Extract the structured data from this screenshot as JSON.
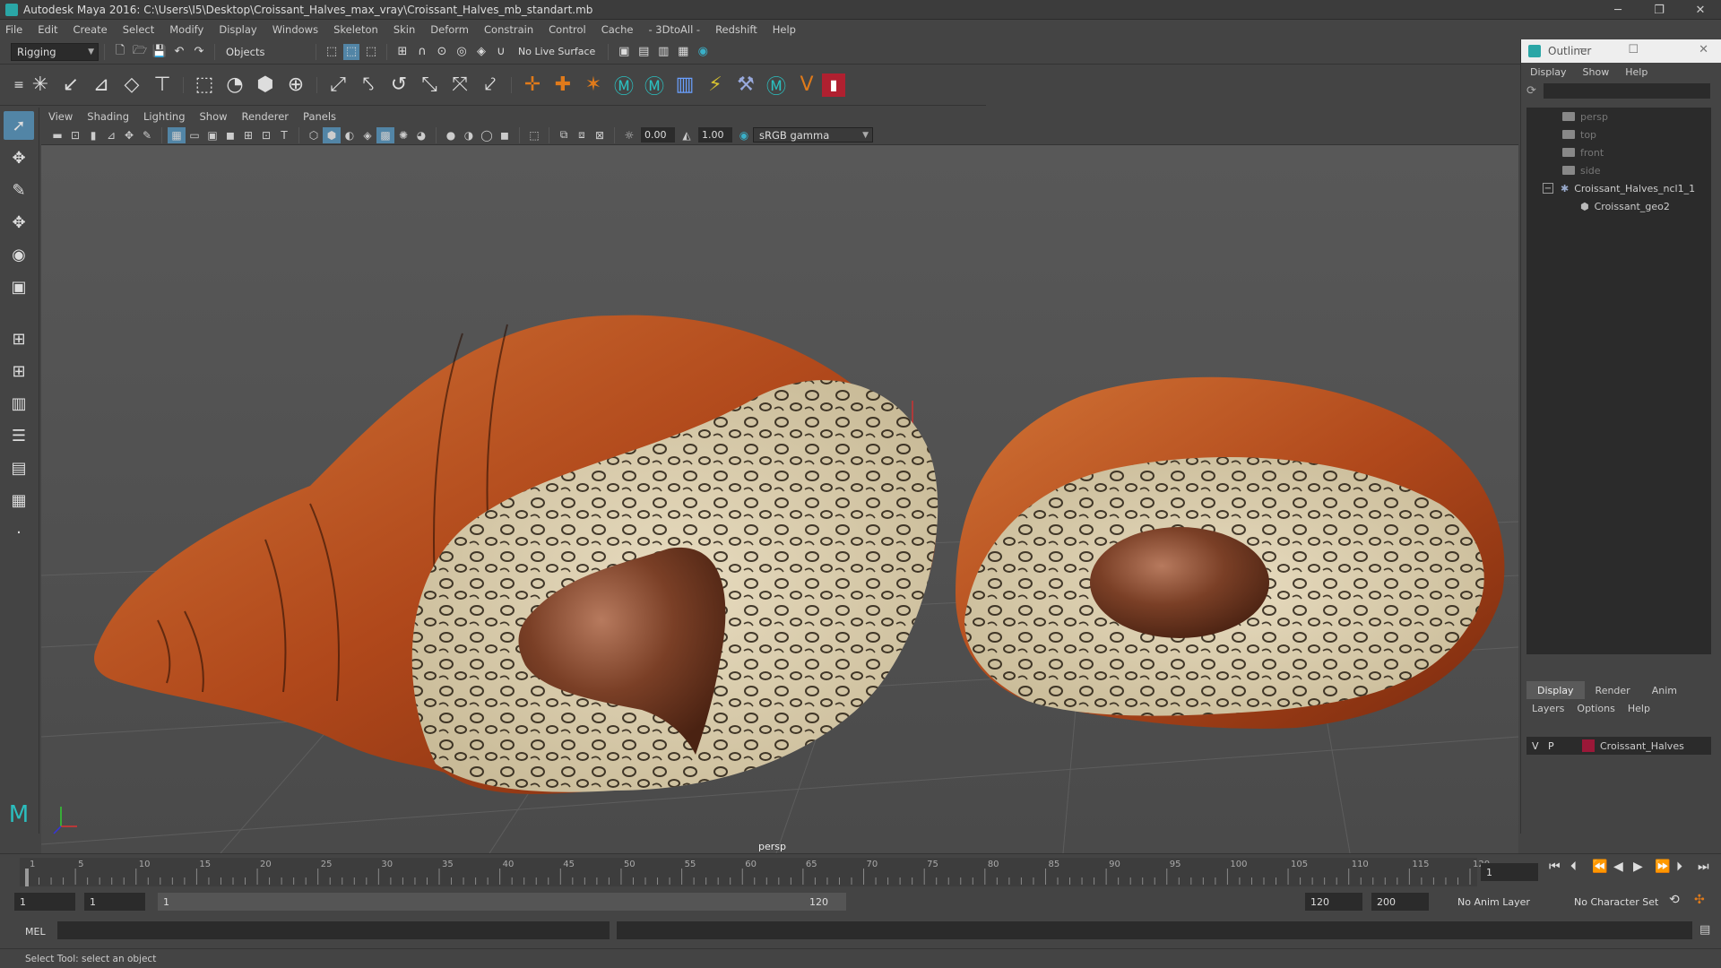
{
  "title_bar": {
    "title": "Autodesk Maya 2016: C:\\Users\\I5\\Desktop\\Croissant_Halves_max_vray\\Croissant_Halves_mb_standart.mb",
    "minimize": "─",
    "maximize": "❐",
    "close": "✕"
  },
  "menu": [
    "File",
    "Edit",
    "Create",
    "Select",
    "Modify",
    "Display",
    "Windows",
    "Skeleton",
    "Skin",
    "Deform",
    "Constrain",
    "Control",
    "Cache",
    "- 3DtoAll -",
    "Redshift",
    "Help"
  ],
  "status_line": {
    "mode": "Rigging",
    "select_mode": "Objects",
    "live_surface": "No Live Surface"
  },
  "panel_menu": [
    "View",
    "Shading",
    "Lighting",
    "Show",
    "Renderer",
    "Panels"
  ],
  "panel_toolbar": {
    "exposure": "0.00",
    "gamma": "1.00",
    "color_space": "sRGB gamma"
  },
  "viewport": {
    "camera": "persp"
  },
  "outliner": {
    "title": "Outliner",
    "menu": [
      "Display",
      "Show",
      "Help"
    ],
    "items": [
      {
        "label": "persp",
        "dim": true
      },
      {
        "label": "top",
        "dim": true
      },
      {
        "label": "front",
        "dim": true
      },
      {
        "label": "side",
        "dim": true
      },
      {
        "label": "Croissant_Halves_ncl1_1",
        "dim": false
      },
      {
        "label": "Croissant_geo2",
        "dim": false
      }
    ]
  },
  "layers": {
    "tabs": [
      "Display",
      "Render",
      "Anim"
    ],
    "menu": [
      "Layers",
      "Options",
      "Help"
    ],
    "layer": {
      "v": "V",
      "p": "P",
      "name": "Croissant_Halves",
      "color": "#9b1838"
    }
  },
  "time_slider": {
    "ticks": [
      "1",
      "5",
      "10",
      "15",
      "20",
      "25",
      "30",
      "35",
      "40",
      "45",
      "50",
      "55",
      "60",
      "65",
      "70",
      "75",
      "80",
      "85",
      "90",
      "95",
      "100",
      "105",
      "110",
      "115",
      "120"
    ],
    "current_frame": "1"
  },
  "range_slider": {
    "start": "1",
    "playback_start": "1",
    "range_inner_start": "1",
    "range_inner_end": "120",
    "playback_end": "120",
    "end": "200",
    "anim_layer": "No Anim Layer",
    "character_set": "No Character Set"
  },
  "command_line": {
    "label": "MEL"
  },
  "help_line": "Select Tool: select an object"
}
